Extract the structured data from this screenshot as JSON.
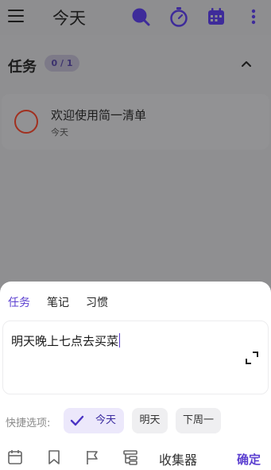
{
  "header": {
    "title": "今天",
    "icons": [
      "menu-icon",
      "search-icon",
      "timer-icon",
      "calendar-icon",
      "more-vert-icon"
    ],
    "accent_color": "#5b3fd0"
  },
  "section": {
    "title": "任务",
    "count": "0 / 1"
  },
  "tasks": [
    {
      "title": "欢迎使用简一清单",
      "date": "今天",
      "checkbox_color": "#a1301f"
    }
  ],
  "sheet": {
    "tabs": [
      {
        "label": "任务",
        "active": true
      },
      {
        "label": "笔记",
        "active": false
      },
      {
        "label": "习惯",
        "active": false
      }
    ],
    "input_value": "明天晚上七点去买菜",
    "quick_label": "快捷选项:",
    "chips": [
      {
        "label": "今天",
        "selected": true
      },
      {
        "label": "明天",
        "selected": false
      },
      {
        "label": "下周一",
        "selected": false
      }
    ],
    "toolbar_icons": [
      "calendar-outline-icon",
      "bookmark-icon",
      "flag-icon",
      "list-tree-icon"
    ],
    "collector_label": "收集器",
    "confirm_label": "确定"
  }
}
